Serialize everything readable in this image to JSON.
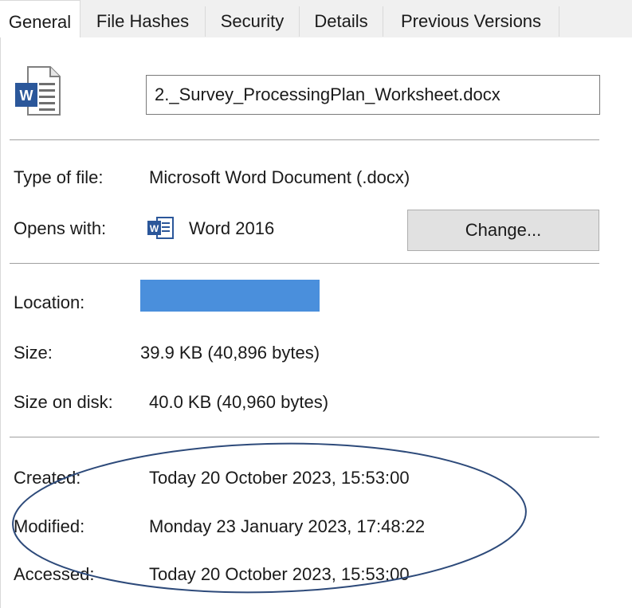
{
  "tabs": [
    {
      "label": "General",
      "active": true
    },
    {
      "label": "File Hashes"
    },
    {
      "label": "Security"
    },
    {
      "label": "Details"
    },
    {
      "label": "Previous Versions"
    }
  ],
  "file": {
    "icon": "word-document-icon",
    "name": "2._Survey_ProcessingPlan_Worksheet.docx"
  },
  "rows": {
    "type_label": "Type of file:",
    "type_value": "Microsoft Word Document (.docx)",
    "opens_label": "Opens with:",
    "opens_app_icon": "word-app-icon",
    "opens_value": "Word 2016",
    "change_button": "Change...",
    "location_label": "Location:",
    "size_label": "Size:",
    "size_value": "39.9 KB (40,896 bytes)",
    "size_disk_label": "Size on disk:",
    "size_disk_value": "40.0 KB (40,960 bytes)",
    "created_label": "Created:",
    "created_value": "Today 20 October 2023, 15:53:00",
    "modified_label": "Modified:",
    "modified_value": "Monday 23 January 2023, 17:48:22",
    "accessed_label": "Accessed:",
    "accessed_value": "Today 20 October 2023, 15:53:00"
  },
  "colors": {
    "word_blue": "#2b579a",
    "redaction": "#4a8fdc",
    "annotation_ellipse": "#2d4a7a"
  }
}
